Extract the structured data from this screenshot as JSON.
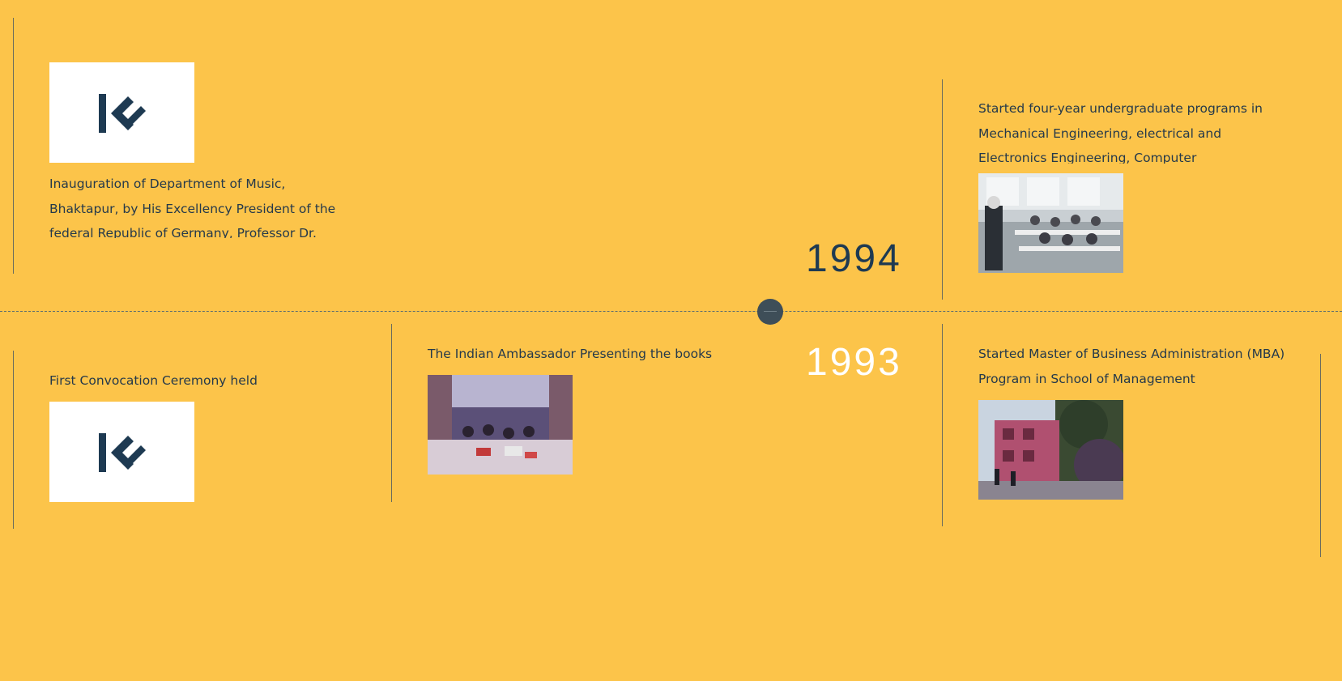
{
  "timeline": {
    "years": [
      {
        "label": "1994",
        "state": "past"
      },
      {
        "label": "1993",
        "state": "current"
      }
    ],
    "colors": {
      "background": "#fcc44a",
      "year_dark": "#1e3a52",
      "year_active": "#ffffff",
      "marker": "#3e4e58"
    }
  },
  "events_1994": [
    {
      "text": "Inauguration of Department of Music, Bhaktapur, by His Excellency President of the federal Republic of Germany, Professor Dr.",
      "media": "university-logo"
    },
    {
      "text": "Started four-year undergraduate programs in Mechanical Engineering, electrical and Electronics Engineering, Computer",
      "media": "classroom-photo"
    }
  ],
  "events_1993": [
    {
      "text": "First Convocation Ceremony held",
      "media": "university-logo"
    },
    {
      "text": "The Indian Ambassador Presenting the books",
      "media": "ceremony-photo"
    },
    {
      "text": "Started Master of Business Administration (MBA) Program in School of Management",
      "media": "campus-building-photo"
    }
  ]
}
